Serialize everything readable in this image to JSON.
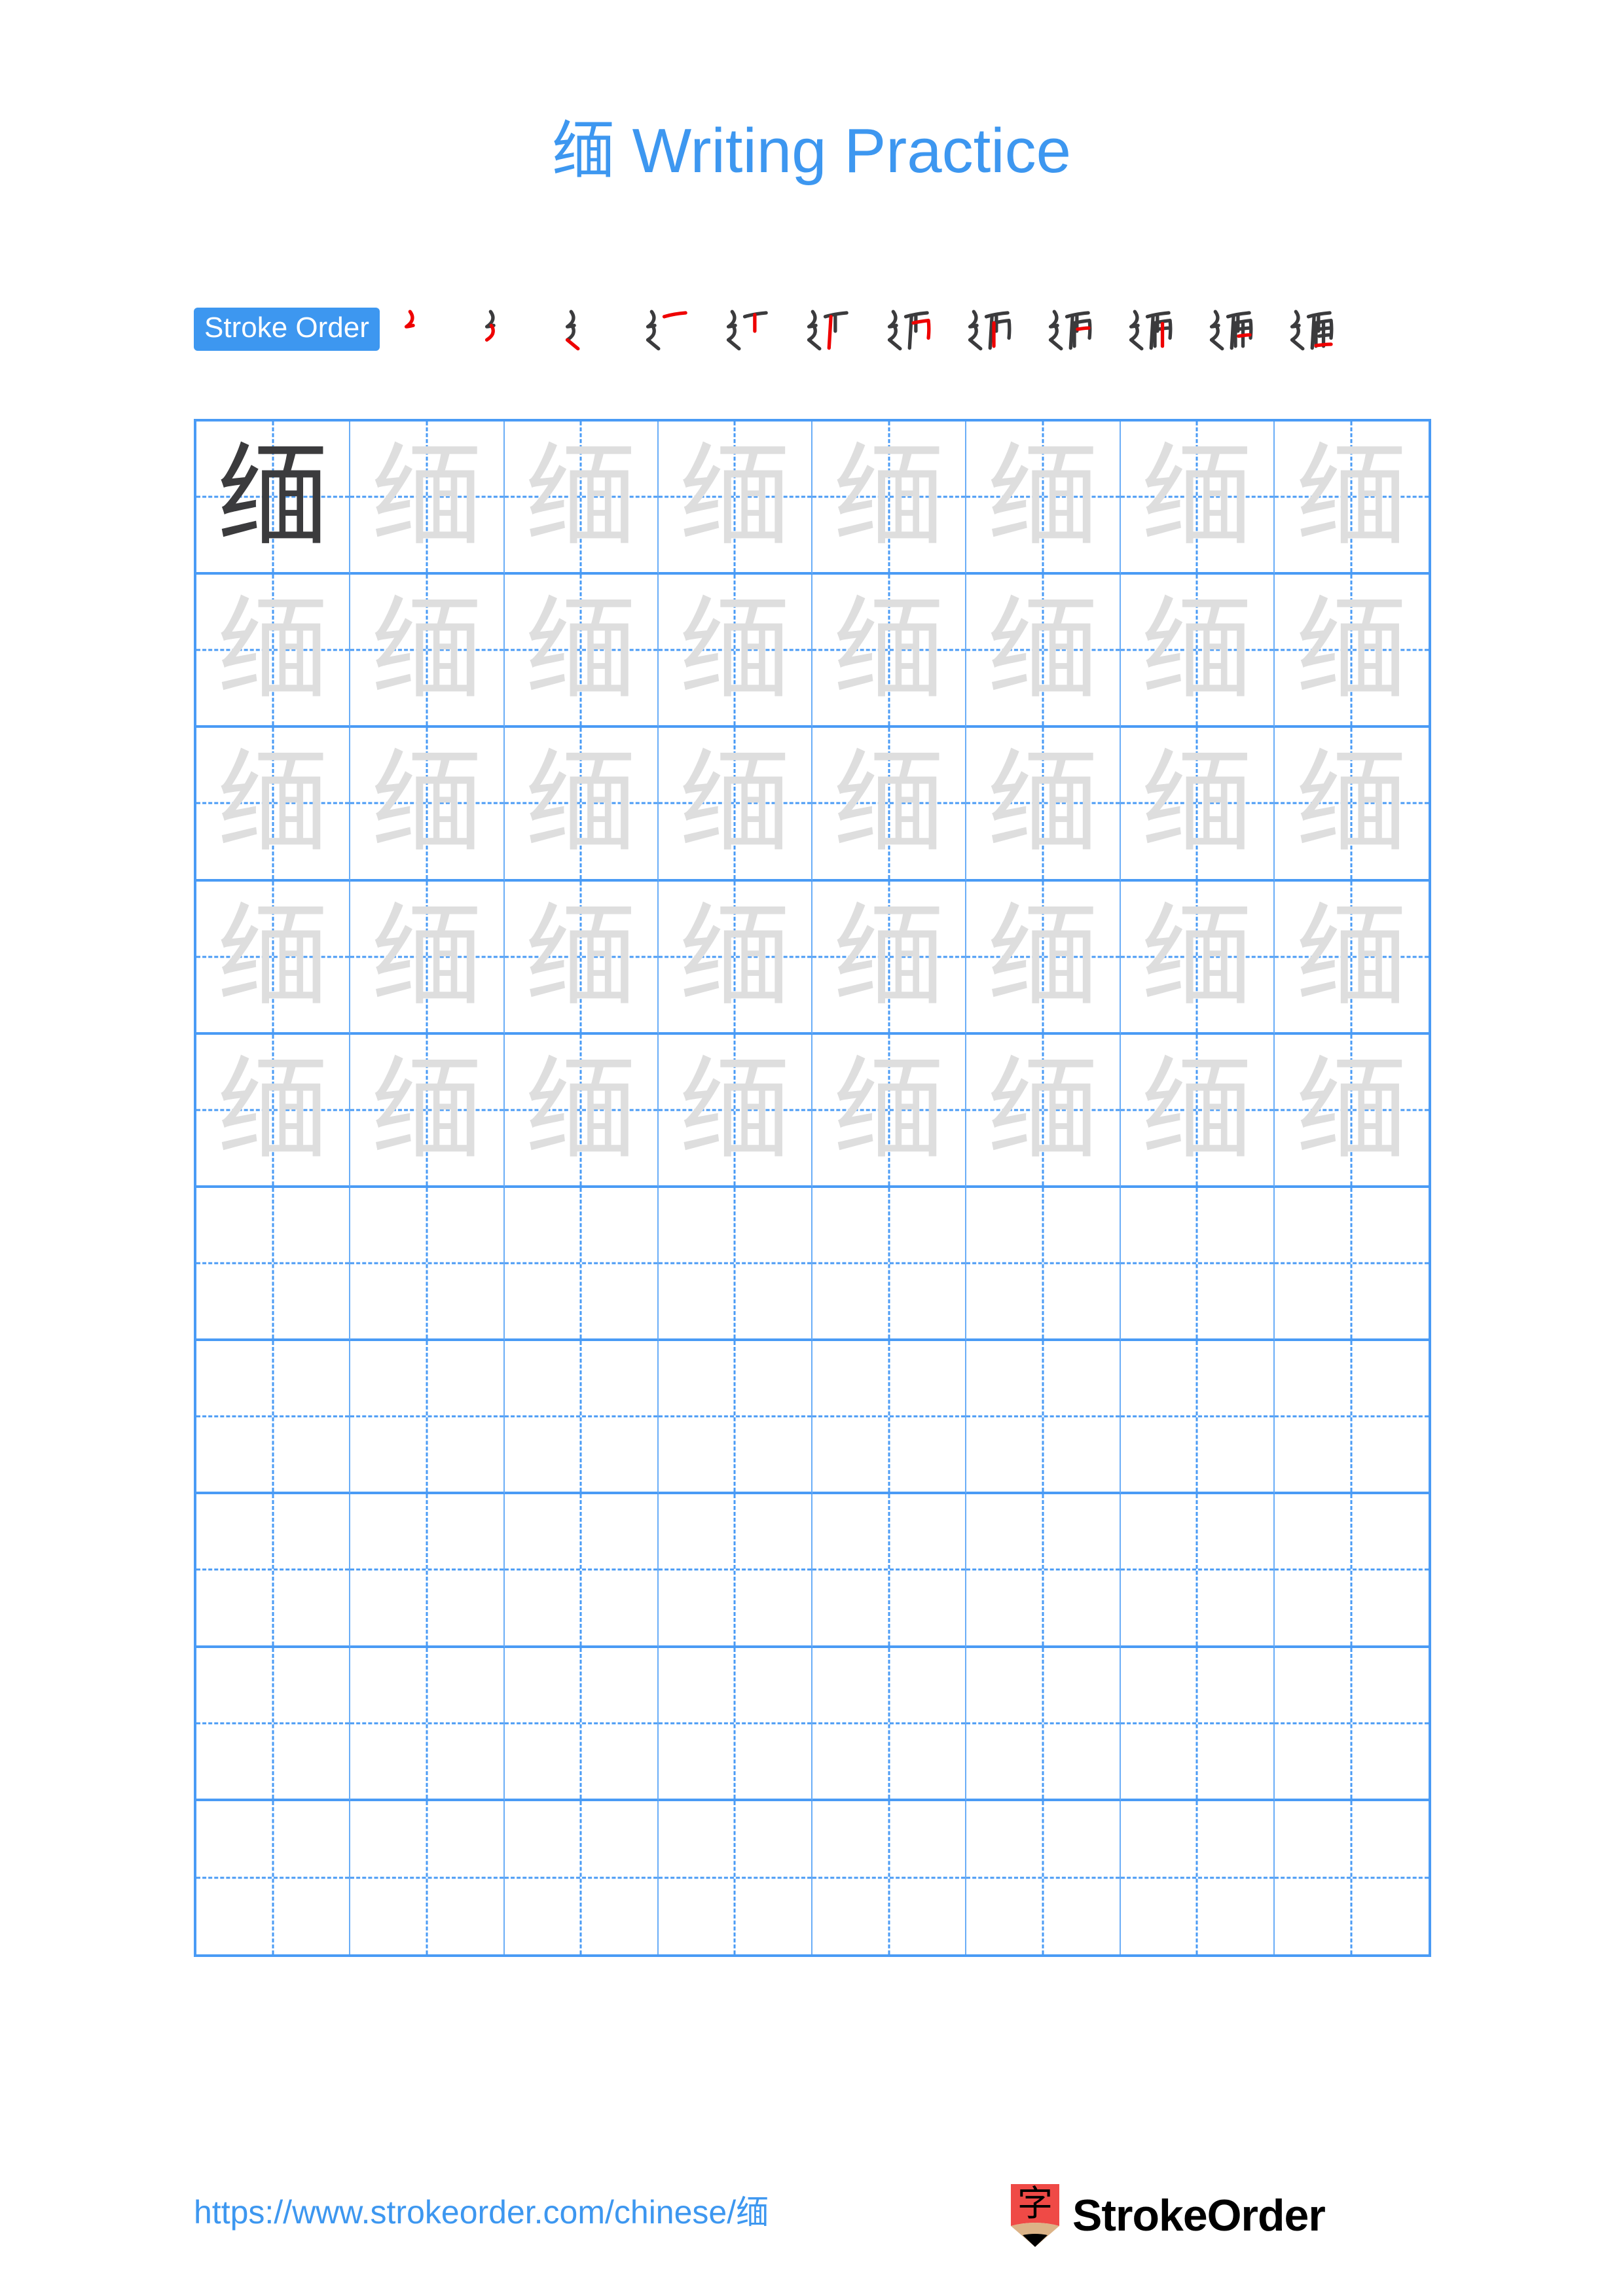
{
  "page": {
    "background_color": "#ffffff",
    "accent_color": "#3d97f0",
    "grid_line_color": "#4a9bf5",
    "trace_color": "#dedede",
    "character_color": "#3b3b3d",
    "stroke_highlight_color": "#ee0000",
    "stroke_existing_color": "#3b3b3d"
  },
  "title": {
    "character": "缅",
    "text": "缅 Writing Practice"
  },
  "stroke_order": {
    "badge_label": "Stroke Order",
    "character": "缅",
    "total_strokes": 12,
    "steps": [
      {
        "index": 1,
        "strokes_shown": 1,
        "new_stroke_color": "#ee0000"
      },
      {
        "index": 2,
        "strokes_shown": 2,
        "new_stroke_color": "#ee0000"
      },
      {
        "index": 3,
        "strokes_shown": 3,
        "new_stroke_color": "#ee0000"
      },
      {
        "index": 4,
        "strokes_shown": 4,
        "new_stroke_color": "#ee0000"
      },
      {
        "index": 5,
        "strokes_shown": 5,
        "new_stroke_color": "#ee0000"
      },
      {
        "index": 6,
        "strokes_shown": 6,
        "new_stroke_color": "#ee0000"
      },
      {
        "index": 7,
        "strokes_shown": 7,
        "new_stroke_color": "#ee0000"
      },
      {
        "index": 8,
        "strokes_shown": 8,
        "new_stroke_color": "#ee0000"
      },
      {
        "index": 9,
        "strokes_shown": 9,
        "new_stroke_color": "#ee0000"
      },
      {
        "index": 10,
        "strokes_shown": 10,
        "new_stroke_color": "#ee0000"
      },
      {
        "index": 11,
        "strokes_shown": 11,
        "new_stroke_color": "#ee0000"
      },
      {
        "index": 12,
        "strokes_shown": 12,
        "new_stroke_color": "#ee0000"
      }
    ]
  },
  "practice_grid": {
    "columns": 8,
    "rows": 10,
    "character": "缅",
    "rows_data": [
      {
        "row": 1,
        "cells": [
          "dark",
          "trace",
          "trace",
          "trace",
          "trace",
          "trace",
          "trace",
          "trace"
        ]
      },
      {
        "row": 2,
        "cells": [
          "trace",
          "trace",
          "trace",
          "trace",
          "trace",
          "trace",
          "trace",
          "trace"
        ]
      },
      {
        "row": 3,
        "cells": [
          "trace",
          "trace",
          "trace",
          "trace",
          "trace",
          "trace",
          "trace",
          "trace"
        ]
      },
      {
        "row": 4,
        "cells": [
          "trace",
          "trace",
          "trace",
          "trace",
          "trace",
          "trace",
          "trace",
          "trace"
        ]
      },
      {
        "row": 5,
        "cells": [
          "trace",
          "trace",
          "trace",
          "trace",
          "trace",
          "trace",
          "trace",
          "trace"
        ]
      },
      {
        "row": 6,
        "cells": [
          "empty",
          "empty",
          "empty",
          "empty",
          "empty",
          "empty",
          "empty",
          "empty"
        ]
      },
      {
        "row": 7,
        "cells": [
          "empty",
          "empty",
          "empty",
          "empty",
          "empty",
          "empty",
          "empty",
          "empty"
        ]
      },
      {
        "row": 8,
        "cells": [
          "empty",
          "empty",
          "empty",
          "empty",
          "empty",
          "empty",
          "empty",
          "empty"
        ]
      },
      {
        "row": 9,
        "cells": [
          "empty",
          "empty",
          "empty",
          "empty",
          "empty",
          "empty",
          "empty",
          "empty"
        ]
      },
      {
        "row": 10,
        "cells": [
          "empty",
          "empty",
          "empty",
          "empty",
          "empty",
          "empty",
          "empty",
          "empty"
        ]
      }
    ]
  },
  "footer": {
    "url": "https://www.strokeorder.com/chinese/缅",
    "brand_name": "StrokeOrder",
    "logo_character": "字",
    "logo_body_color": "#ef4a46",
    "logo_wood_color": "#dcb387",
    "logo_tip_color": "#000000"
  }
}
